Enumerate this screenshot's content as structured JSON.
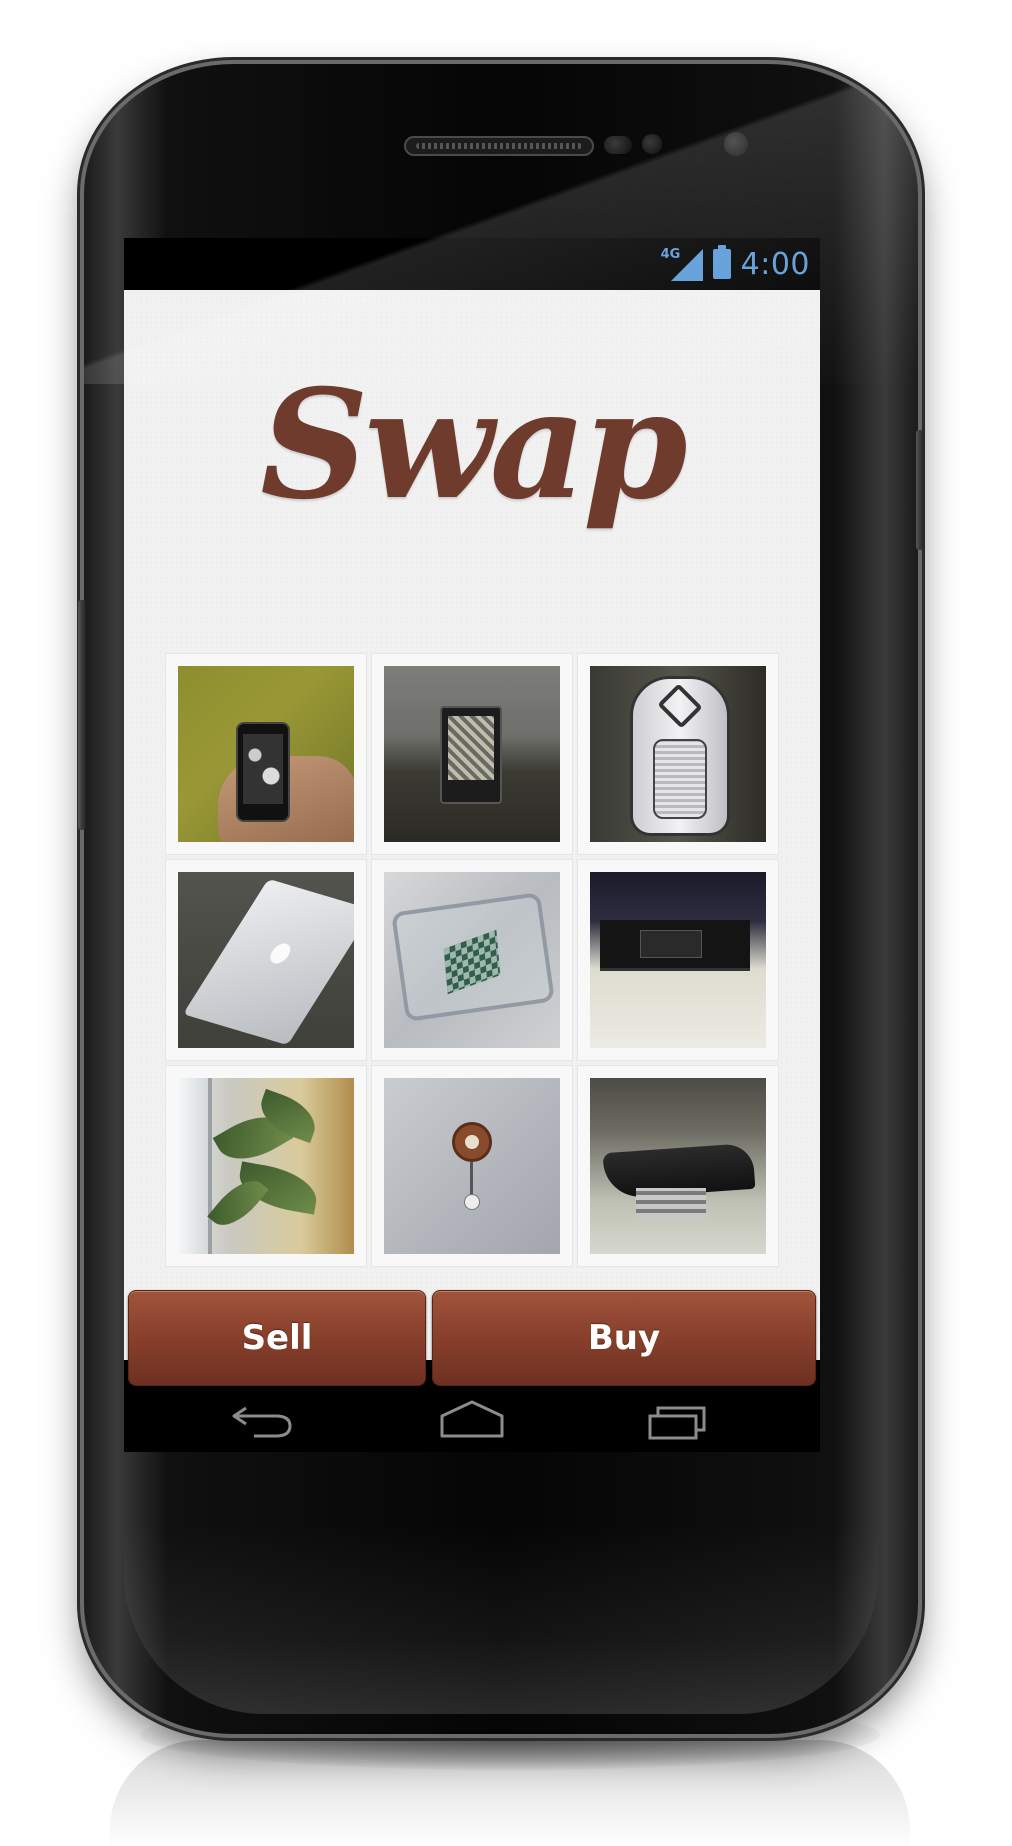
{
  "status_bar": {
    "network": "4G",
    "time": "4:00"
  },
  "app": {
    "logo_text": "Swap",
    "logo_color": "#6e3b2c",
    "accent_color": "#8a412c",
    "items": [
      {
        "photo": "phone"
      },
      {
        "photo": "e-reader"
      },
      {
        "photo": "backpack"
      },
      {
        "photo": "laptop"
      },
      {
        "photo": "glass table with chess board"
      },
      {
        "photo": "tv stand"
      },
      {
        "photo": "plant"
      },
      {
        "photo": "wall clock"
      },
      {
        "photo": "coffee table"
      }
    ],
    "buttons": {
      "sell": "Sell",
      "buy": "Buy"
    }
  },
  "nav": {
    "icons": [
      "back-icon",
      "home-icon",
      "recent-apps-icon"
    ]
  }
}
